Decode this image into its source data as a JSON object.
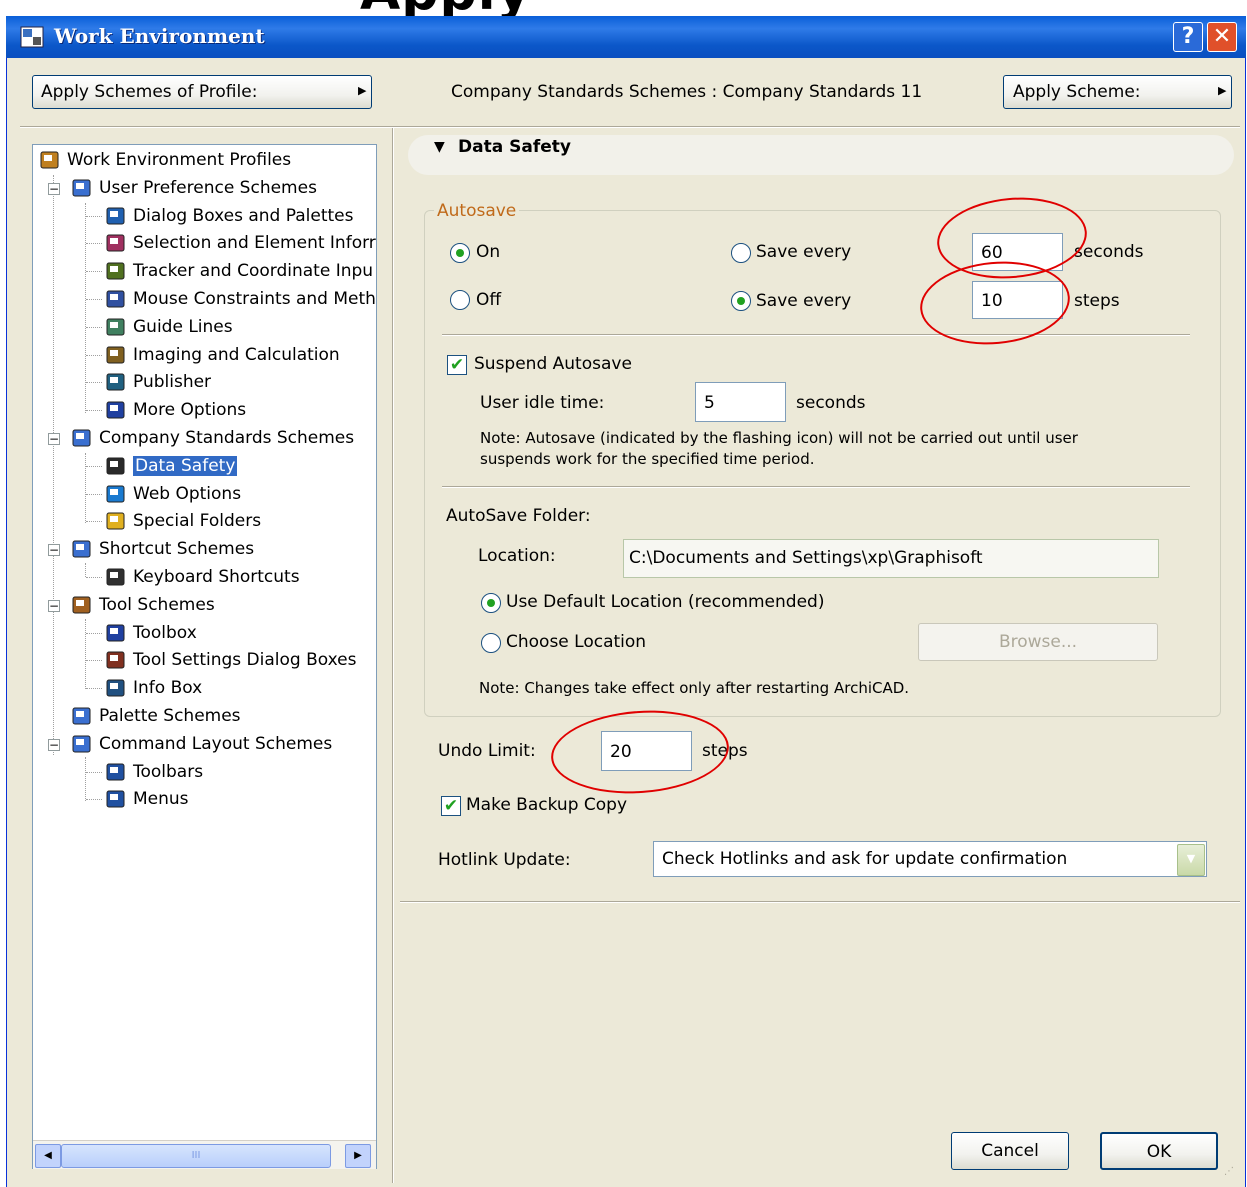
{
  "banner": {
    "text": "Apply"
  },
  "window": {
    "title": "Work Environment",
    "help_label": "?",
    "close_label": "✕"
  },
  "top": {
    "apply_profile_label": "Apply Schemes of Profile:",
    "scheme_info": "Company Standards Schemes : Company Standards 11",
    "apply_scheme_label": "Apply Scheme:"
  },
  "tree": {
    "items": [
      {
        "label": "Work Environment Profiles",
        "icon": "profiles-icon"
      },
      {
        "label": "User Preference Schemes",
        "icon": "user-schemes-icon"
      },
      {
        "label": "Dialog Boxes and Palettes",
        "icon": "dialog-icon"
      },
      {
        "label": "Selection and Element Inforr",
        "icon": "selection-icon"
      },
      {
        "label": "Tracker and Coordinate Inpu",
        "icon": "tracker-icon"
      },
      {
        "label": "Mouse Constraints and Meth",
        "icon": "mouse-icon"
      },
      {
        "label": "Guide Lines",
        "icon": "guide-icon"
      },
      {
        "label": "Imaging and Calculation",
        "icon": "imaging-icon"
      },
      {
        "label": "Publisher",
        "icon": "publisher-icon"
      },
      {
        "label": "More Options",
        "icon": "options-icon"
      },
      {
        "label": "Company Standards Schemes",
        "icon": "company-schemes-icon"
      },
      {
        "label": "Data Safety",
        "icon": "data-safety-icon"
      },
      {
        "label": "Web Options",
        "icon": "globe-icon"
      },
      {
        "label": "Special Folders",
        "icon": "folder-icon"
      },
      {
        "label": "Shortcut Schemes",
        "icon": "shortcut-schemes-icon"
      },
      {
        "label": "Keyboard Shortcuts",
        "icon": "shortcut-icon"
      },
      {
        "label": "Tool Schemes",
        "icon": "tool-schemes-icon"
      },
      {
        "label": "Toolbox",
        "icon": "toolbox-icon"
      },
      {
        "label": "Tool Settings Dialog Boxes",
        "icon": "tool-settings-icon"
      },
      {
        "label": "Info Box",
        "icon": "info-box-icon"
      },
      {
        "label": "Palette Schemes",
        "icon": "palette-schemes-icon"
      },
      {
        "label": "Command Layout Schemes",
        "icon": "command-schemes-icon"
      },
      {
        "label": "Toolbars",
        "icon": "toolbars-icon"
      },
      {
        "label": "Menus",
        "icon": "menus-icon"
      }
    ],
    "scroll_left": "◀",
    "scroll_right": "▶",
    "scroll_grip": "III"
  },
  "panel": {
    "header": "Data Safety",
    "autosave": {
      "group_label": "Autosave",
      "on_label": "On",
      "off_label": "Off",
      "save_every_label": "Save every",
      "seconds_value": "60",
      "seconds_unit": "seconds",
      "steps_value": "10",
      "steps_unit": "steps",
      "suspend_label": "Suspend Autosave",
      "idle_label": "User idle time:",
      "idle_value": "5",
      "idle_unit": "seconds",
      "note1": "Note: Autosave (indicated by the flashing icon) will not be carried out until user",
      "note2": "suspends work for the specified time period.",
      "folder_label": "AutoSave Folder:",
      "location_label": "Location:",
      "location_value": "C:\\Documents and Settings\\xp\\Graphisoft",
      "default_location_label": "Use Default Location (recommended)",
      "choose_location_label": "Choose Location",
      "browse_label": "Browse...",
      "note3": "Note: Changes take effect only after restarting ArchiCAD."
    },
    "undo": {
      "label": "Undo Limit:",
      "value": "20",
      "unit": "steps"
    },
    "backup_label": "Make Backup Copy",
    "hotlink": {
      "label": "Hotlink Update:",
      "value": "Check Hotlinks and ask for update confirmation"
    }
  },
  "buttons": {
    "cancel": "Cancel",
    "ok": "OK"
  },
  "colors": {
    "title_bar": "#0a5fd8",
    "face": "#ece9d8",
    "annotation": "#e00000",
    "check_green": "#21a121"
  }
}
